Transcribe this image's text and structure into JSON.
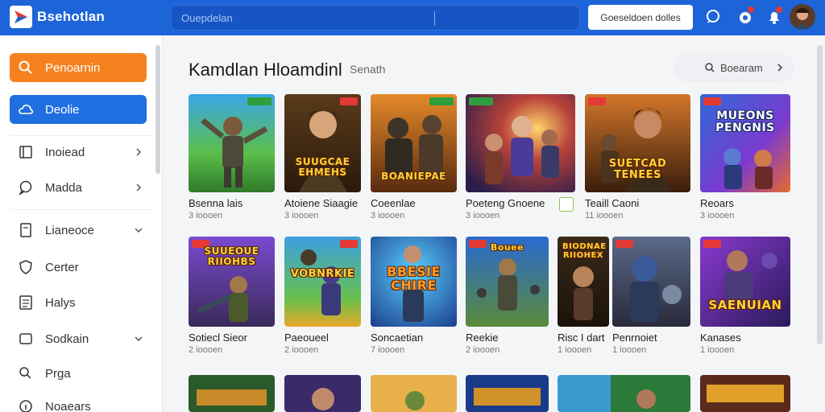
{
  "app": {
    "brand": "Bsehotlan",
    "search_placeholder": "Ouepdelan",
    "top_button_label": "Goeseldoen dolles",
    "accent_color": "#1d64d8"
  },
  "topbar_icons": [
    "logo-icon",
    "chat-icon",
    "notification-icon",
    "bell-icon",
    "user-avatar"
  ],
  "sidebar": {
    "items": [
      {
        "label": "Penoarnin",
        "icon": "search-icon",
        "style": "orange",
        "chevron": false
      },
      {
        "label": "Deolie",
        "icon": "cloud-icon",
        "style": "blue",
        "chevron": false
      },
      {
        "label": "Inoiead",
        "icon": "folder-icon",
        "style": "plain",
        "chevron": "right"
      },
      {
        "label": "Madda",
        "icon": "chat-icon",
        "style": "plain",
        "chevron": "right"
      },
      {
        "label": "Lianeoce",
        "icon": "document-icon",
        "style": "plain",
        "chevron": "down"
      },
      {
        "label": "Certer",
        "icon": "shield-icon",
        "style": "plain",
        "chevron": false
      },
      {
        "label": "Halys",
        "icon": "list-icon",
        "style": "plain",
        "chevron": false
      },
      {
        "label": "Sodkain",
        "icon": "box-icon",
        "style": "plain",
        "chevron": "down"
      },
      {
        "label": "Prga",
        "icon": "search-icon",
        "style": "plain",
        "chevron": false
      },
      {
        "label": "Noaears",
        "icon": "info-icon",
        "style": "plain",
        "chevron": false
      }
    ]
  },
  "main": {
    "title": "Kamdlan Hloamdinl",
    "subtitle": "Senath",
    "filter_button": "Boearam"
  },
  "cards": [
    {
      "title": "Bsenna lais",
      "meta": "3 ioooen",
      "art": "Soldier on green field",
      "label": ""
    },
    {
      "title": "Atoiene Siaagie",
      "meta": "3 ioooen",
      "art": "Hero portrait",
      "label": "SUUGCAE\nEHMEHS"
    },
    {
      "title": "Coeenlae",
      "meta": "3 ioooen",
      "art": "Soldiers",
      "label": "BOANIEPAE"
    },
    {
      "title": "Poeteng Gnoene",
      "meta": "3 ioooen",
      "art": "Space heroes",
      "label": ""
    },
    {
      "title": "Teaill Caoni",
      "meta": "11 ioooen",
      "art": "Hero",
      "label": "SUETCAD\nTENEES"
    },
    {
      "title": "Reoars",
      "meta": "3 ioooen",
      "art": "Title card",
      "label": "MUEONS\nPENGNIS"
    },
    {
      "title": "Sotiecl Sieor",
      "meta": "2 ioooen",
      "art": "Hunter",
      "label": "SUUEOUE\nRIIOHBS"
    },
    {
      "title": "Paeoueel",
      "meta": "2 ioooen",
      "art": "Knight",
      "label": "VOBNRKIE"
    },
    {
      "title": "Soncaetian",
      "meta": "7 ioooen",
      "art": "Soldier",
      "label": "BBESIE\nCHIRE"
    },
    {
      "title": "Reekie",
      "meta": "2 ioooen",
      "art": "Army",
      "label": "Bouee"
    },
    {
      "title": "Risc I dart",
      "meta": "1 ioooen",
      "art": "Gladiator",
      "label": "BIODNAE\nRIIOHEX"
    },
    {
      "title": "Penrnoiet",
      "meta": "1 ioooen",
      "art": "Robot warrior",
      "label": ""
    },
    {
      "title": "Kanases",
      "meta": "1 ioooen",
      "art": "Brawler",
      "label": "SAENUIAN"
    }
  ]
}
